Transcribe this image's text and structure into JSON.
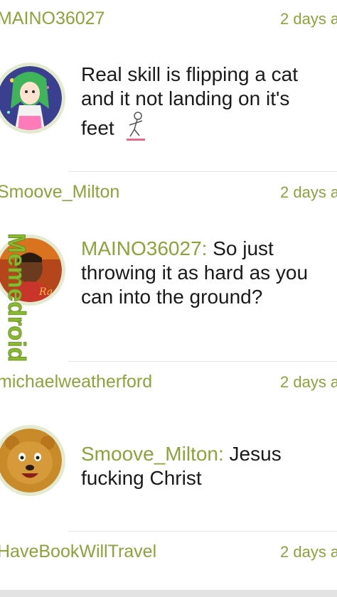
{
  "comments": [
    {
      "username": "MAINO36027",
      "time": "2 days a",
      "mention": "",
      "text": "Real skill is flipping a cat and it not landing on it's feet",
      "avatar_icon": "anime-girl-avatar"
    },
    {
      "username": "Smoove_Milton",
      "time": "2 days a",
      "mention": "MAINO36027:",
      "text": " So just throwing it as hard as you can into the ground?",
      "avatar_icon": "rapper-avatar"
    },
    {
      "username": "michaelweatherford",
      "time": "2 days a",
      "mention": "Smoove_Milton:",
      "text": " Jesus fucking Christ",
      "avatar_icon": "cartoon-bear-avatar"
    },
    {
      "username": "HaveBookWillTravel",
      "time": "2 days a",
      "mention": "",
      "text": "",
      "avatar_icon": ""
    }
  ],
  "watermark": "Memedroid",
  "colors": {
    "accent": "#8aa33a",
    "text": "#1a1a1a",
    "watermark": "#8ab830"
  }
}
